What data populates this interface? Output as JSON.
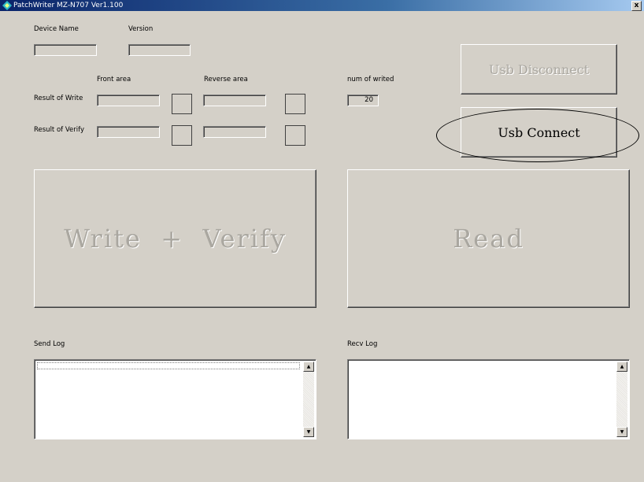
{
  "window": {
    "title": "PatchWriter MZ-N707 Ver1.100",
    "close_glyph": "x",
    "icon": "app-icon"
  },
  "device": {
    "name_label": "Device Name",
    "name_value": "",
    "version_label": "Version",
    "version_value": ""
  },
  "results": {
    "front_area_label": "Front area",
    "reverse_area_label": "Reverse area",
    "write_label": "Result of Write",
    "verify_label": "Result of Verify",
    "front_write_value": "",
    "reverse_write_value": "",
    "front_verify_value": "",
    "reverse_verify_value": ""
  },
  "counter": {
    "label": "num of writed",
    "value": "20"
  },
  "buttons": {
    "usb_disconnect": "Usb Disconnect",
    "usb_connect": "Usb Connect",
    "write_verify": "Write  +  Verify",
    "read": "Read"
  },
  "logs": {
    "send_label": "Send Log",
    "recv_label": "Recv Log",
    "send_content": "",
    "recv_content": ""
  },
  "colors": {
    "face": "#d4d0c8",
    "title_start": "#0a246a",
    "title_end": "#a6caf0",
    "disabled_text": "#aaa7a0"
  }
}
